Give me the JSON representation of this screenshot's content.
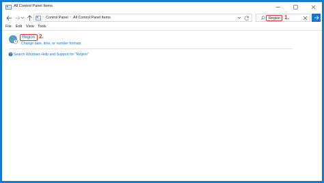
{
  "window": {
    "title": "All Control Panel Items",
    "minimize_label": "—",
    "maximize_label": "☐",
    "close_label": "✕"
  },
  "address": {
    "crumbs": [
      "Control Panel",
      "All Control Panel Items"
    ],
    "separator": "›"
  },
  "search": {
    "value": "Region",
    "step_label": "1."
  },
  "menu": {
    "items": [
      "File",
      "Edit",
      "View",
      "Tools"
    ]
  },
  "result": {
    "title": "Region",
    "step_label": "2.",
    "subtitle": "Change date, time, or number formats"
  },
  "help": {
    "link": "Search Windows Help and Support for \"Region\""
  },
  "colors": {
    "accent": "#1a73d0",
    "annotation": "#e0302a",
    "desktop": "#0f7ed9"
  },
  "icons": {
    "title": "control-panel-icon",
    "back": "back-arrow-icon",
    "forward": "forward-arrow-icon",
    "recent": "chevron-down-icon",
    "up": "up-arrow-icon",
    "search_go": "arrow-right-icon",
    "result": "globe-clock-icon",
    "help": "help-icon"
  }
}
